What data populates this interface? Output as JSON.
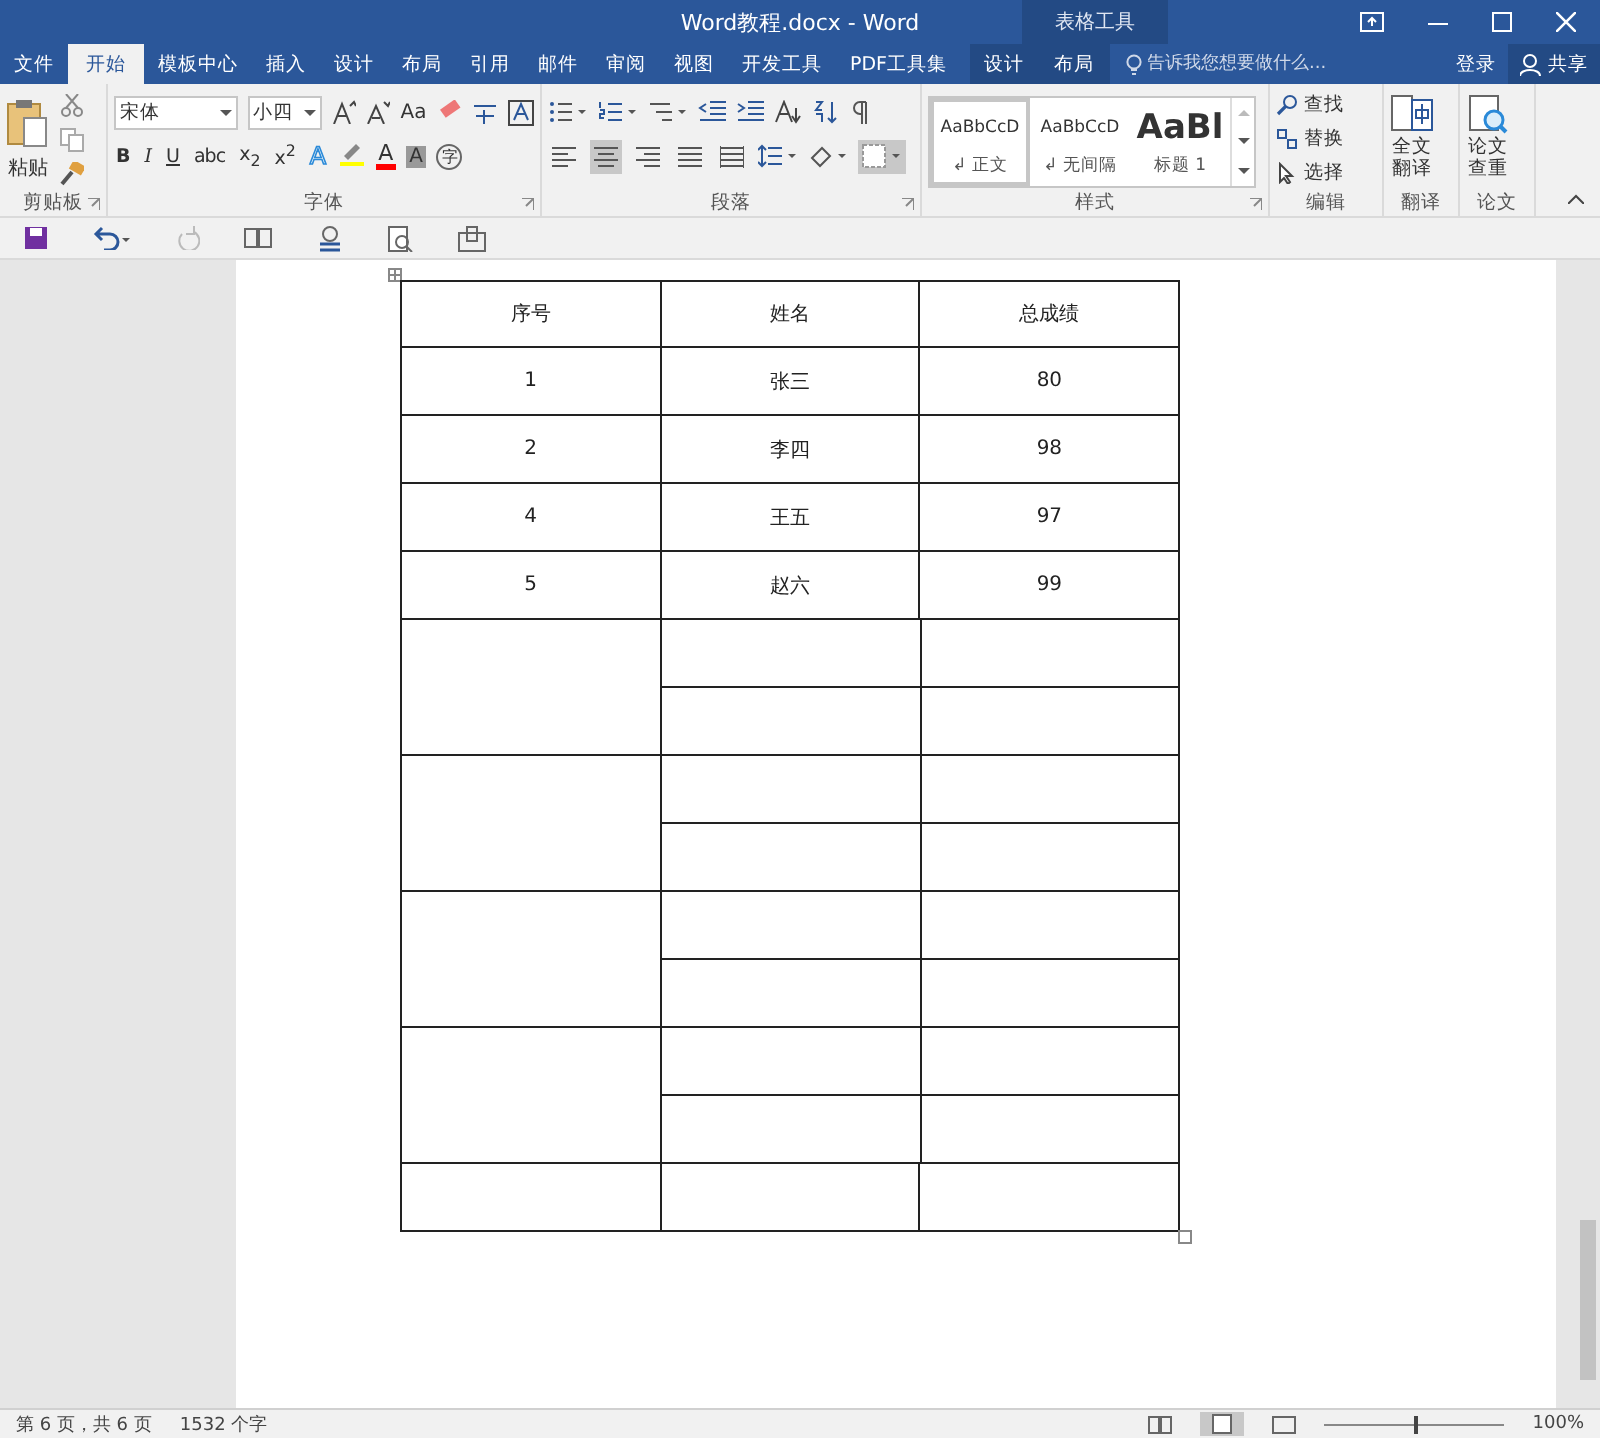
{
  "window": {
    "title": "Word教程.docx - Word",
    "context_title": "表格工具"
  },
  "tabs": [
    {
      "label": "文件",
      "selected": false
    },
    {
      "label": "开始",
      "selected": true
    },
    {
      "label": "模板中心",
      "selected": false
    },
    {
      "label": "插入",
      "selected": false
    },
    {
      "label": "设计",
      "selected": false
    },
    {
      "label": "布局",
      "selected": false
    },
    {
      "label": "引用",
      "selected": false
    },
    {
      "label": "邮件",
      "selected": false
    },
    {
      "label": "审阅",
      "selected": false
    },
    {
      "label": "视图",
      "selected": false
    },
    {
      "label": "开发工具",
      "selected": false
    },
    {
      "label": "PDF工具集",
      "selected": false
    }
  ],
  "context_tabs": [
    {
      "label": "设计",
      "selected": false
    },
    {
      "label": "布局",
      "selected": false
    }
  ],
  "search": {
    "placeholder": "告诉我您想要做什么..."
  },
  "account": {
    "login": "登录",
    "share": "共享"
  },
  "ribbon": {
    "clipboard": {
      "paste": "粘贴",
      "group": "剪贴板"
    },
    "font": {
      "name": "宋体",
      "size": "小四",
      "case_button": "Aa",
      "group": "字体",
      "buttons": [
        {
          "label": "B",
          "kind": "bold"
        },
        {
          "label": "I",
          "kind": "italic"
        },
        {
          "label": "U",
          "kind": "underline"
        },
        {
          "label": "abc",
          "kind": "strike"
        },
        {
          "label": "x$_{2}$",
          "kind": "plain"
        },
        {
          "label": "x$^{2}$",
          "kind": "plain"
        }
      ],
      "color_buttons": [
        {
          "label": "A",
          "kind": "effect"
        },
        {
          "label": "A",
          "kind": "font-color",
          "color": "#ff0000"
        },
        {
          "label": "A",
          "kind": "shading"
        },
        {
          "label": "字",
          "kind": "enclosed"
        }
      ]
    },
    "paragraph": {
      "group": "段落",
      "alignments": [
        {
          "selected": false
        },
        {
          "selected": true
        },
        {
          "selected": false
        },
        {
          "selected": false
        },
        {
          "selected": false
        }
      ]
    },
    "styles": {
      "group": "样式",
      "items": [
        {
          "preview": "AaBbCcD",
          "label": "↲ 正文",
          "selected": true,
          "kind": "normal"
        },
        {
          "preview": "AaBbCcD",
          "label": "↲ 无间隔",
          "selected": false,
          "kind": "normal"
        },
        {
          "preview": "AaBl",
          "label": "标题 1",
          "selected": false,
          "kind": "heading"
        }
      ]
    },
    "editing": {
      "group": "编辑",
      "items": [
        "查找",
        "替换",
        "选择"
      ]
    },
    "translate": {
      "button": "全文翻译",
      "group": "翻译"
    },
    "thesis": {
      "button": "论文查重",
      "group": "论文"
    }
  },
  "table": {
    "columns": [
      "序号",
      "姓名",
      "总成绩"
    ],
    "rows": [
      [
        "1",
        "张三",
        "80"
      ],
      [
        "2",
        "李四",
        "98"
      ],
      [
        "4",
        "王五",
        "97"
      ],
      [
        "5",
        "赵六",
        "99"
      ]
    ],
    "blank_blocks": [
      {
        "kind": "merged"
      },
      {
        "kind": "merged"
      },
      {
        "kind": "merged"
      },
      {
        "kind": "merged"
      },
      {
        "kind": "single"
      }
    ]
  },
  "status_bar": {
    "page": "第 6 页，共 6 页",
    "words": "1532 个字",
    "zoom": "100%",
    "zoom_slider": {
      "level": 0.5
    }
  }
}
